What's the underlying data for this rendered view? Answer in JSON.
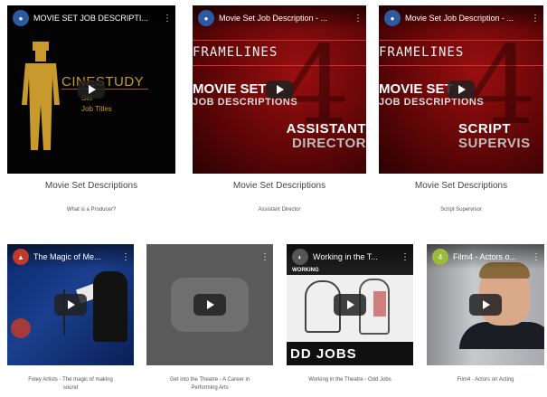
{
  "top_row": [
    {
      "video_title": "MOVIE SET JOB DESCRIPTI...",
      "thumb": {
        "brand": "CINESTUDY",
        "line1": "Set",
        "line2": "Job Titles"
      },
      "caption": "Movie Set Descriptions",
      "subcaption": "What is a Producer?"
    },
    {
      "video_title": "Movie Set Job Description - ...",
      "thumb": {
        "brand": "FRAMELINES",
        "line1": "MOVIE SET",
        "line2": "JOB DESCRIPTIONS",
        "role1": "ASSISTANT",
        "role2": "DIRECTOR"
      },
      "caption": "Movie Set Descriptions",
      "subcaption": "Assistant Director"
    },
    {
      "video_title": "Movie Set Job Description - ...",
      "thumb": {
        "brand": "FRAMELINES",
        "line1": "MOVIE SET",
        "line2": "JOB DESCRIPTIONS",
        "role1": "SCRIPT",
        "role2": "SUPERVIS"
      },
      "caption": "Movie Set Descriptions",
      "subcaption": "Script Supervisor"
    }
  ],
  "bottom_row": [
    {
      "video_title": "The Magic of Me...",
      "subcaption_l1": "Foley Artists - The magic of making",
      "subcaption_l2": "sound"
    },
    {
      "video_title": "",
      "subcaption_l1": "Get into the Theatre - A Career in",
      "subcaption_l2": "Performing Arts"
    },
    {
      "video_title": "Working in the T...",
      "thumb": {
        "header": "WORKING",
        "overlay": "DD JOBS"
      },
      "subcaption_l1": "Working in the Theatre - Odd Jobs",
      "subcaption_l2": ""
    },
    {
      "video_title": "Film4 - Actors o...",
      "subcaption_l1": "Film4 - Actors on Acting",
      "subcaption_l2": ""
    }
  ],
  "colors": {
    "accent_gold": "#c89a2e",
    "frame_red": "#9a0f10",
    "play_button": "#212121"
  },
  "icons": [
    "play-button-icon",
    "more-options-icon",
    "channel-avatar-icon"
  ]
}
